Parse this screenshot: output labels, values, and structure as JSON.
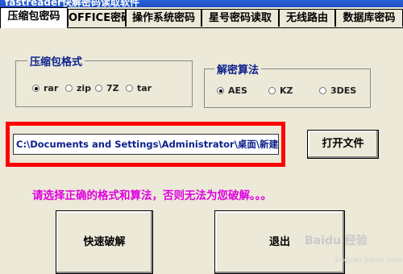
{
  "window": {
    "title": "fastreader快解密码读取软件"
  },
  "tabs": [
    {
      "label": "压缩包密码"
    },
    {
      "label": "OFFICE密码"
    },
    {
      "label": "操作系统密码"
    },
    {
      "label": "星号密码读取"
    },
    {
      "label": "无线路由"
    },
    {
      "label": "数据库密码"
    }
  ],
  "format_group": {
    "title": "压缩包格式",
    "options": [
      {
        "label": "rar",
        "selected": true
      },
      {
        "label": "zip",
        "selected": false
      },
      {
        "label": "7Z",
        "selected": false
      },
      {
        "label": "tar",
        "selected": false
      }
    ]
  },
  "algorithm_group": {
    "title": "解密算法",
    "options": [
      {
        "label": "AES",
        "selected": true
      },
      {
        "label": "KZ",
        "selected": false
      },
      {
        "label": "3DES",
        "selected": false
      }
    ]
  },
  "file_path": "C:\\Documents and Settings\\Administrator\\桌面\\新建文件夹\\新",
  "open_button": "打开文件",
  "message": "请选择正确的格式和算法，否则无法为您破解。。。",
  "quick_crack_button": "快速破解",
  "exit_button": "退出",
  "watermark": {
    "main": "Baidu 经验",
    "sub": "jingyan.baidu.com"
  },
  "colors": {
    "highlight": "#ff0000",
    "message": "#e000e0",
    "group_title": "#0b1f8c"
  }
}
